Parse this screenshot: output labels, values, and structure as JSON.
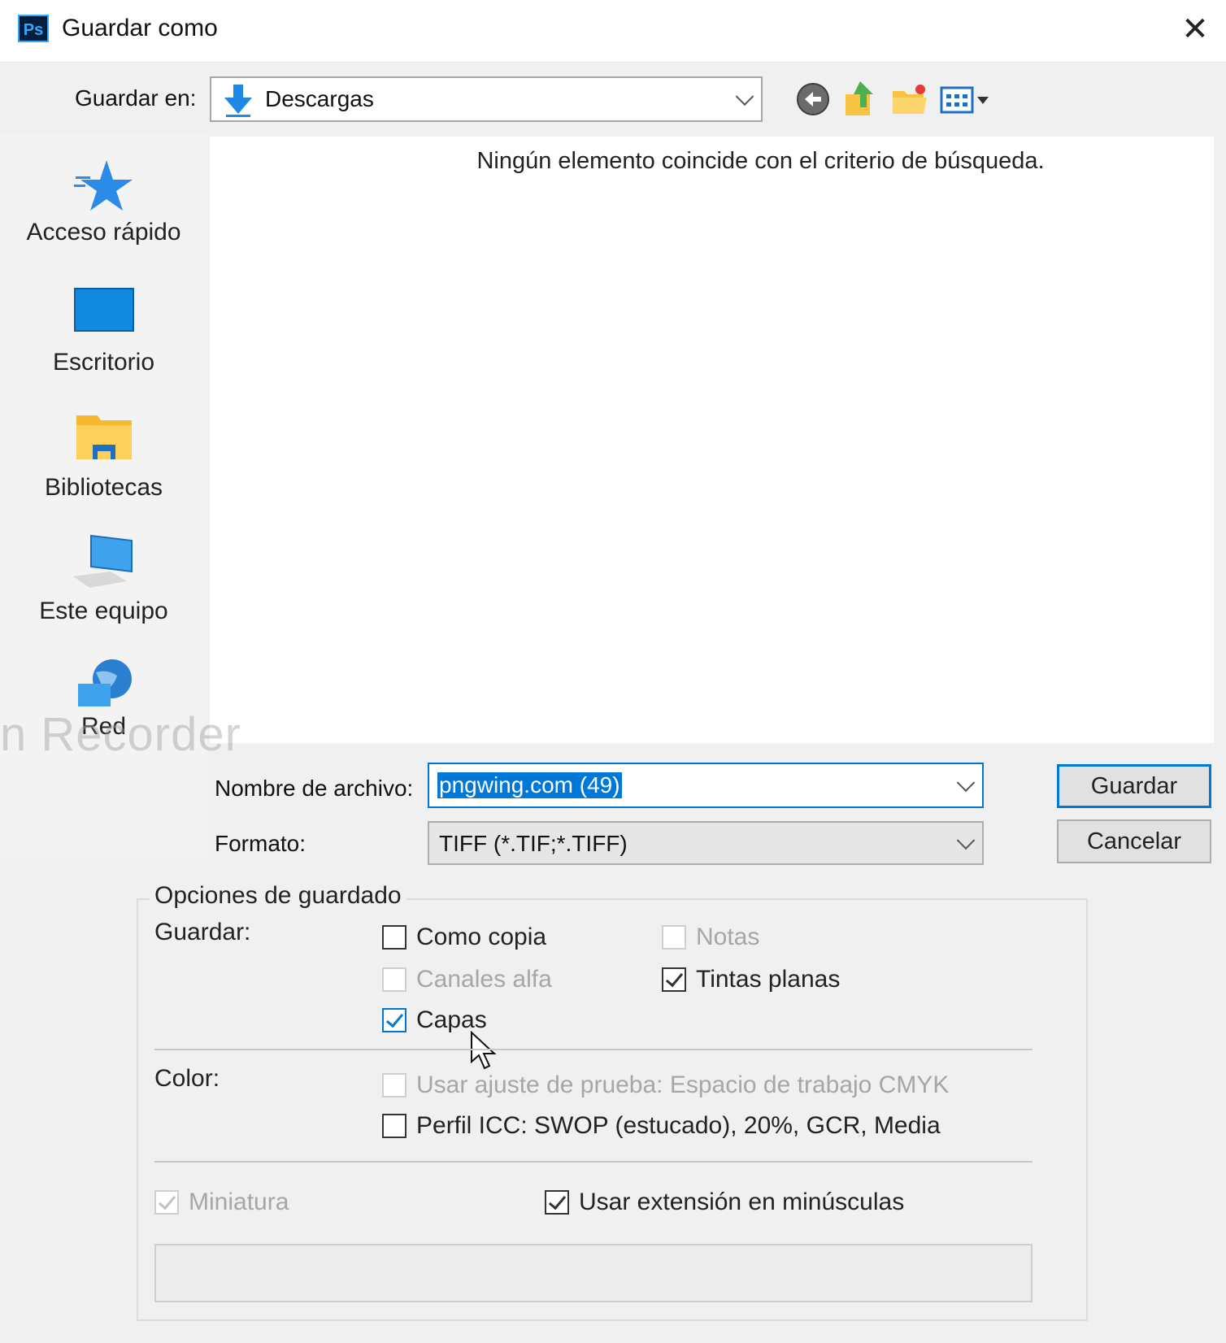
{
  "window": {
    "app_icon_text": "Ps",
    "title": "Guardar como",
    "close_glyph": "✕"
  },
  "location": {
    "label": "Guardar en:",
    "value": "Descargas"
  },
  "sidebar": {
    "items": [
      {
        "label": "Acceso rápido",
        "icon": "star-icon"
      },
      {
        "label": "Escritorio",
        "icon": "desktop-icon"
      },
      {
        "label": "Bibliotecas",
        "icon": "libraries-icon"
      },
      {
        "label": "Este equipo",
        "icon": "computer-icon"
      },
      {
        "label": "Red",
        "icon": "network-icon"
      }
    ]
  },
  "file_list": {
    "empty_message": "Ningún elemento coincide con el criterio de búsqueda."
  },
  "file_name": {
    "label": "Nombre de archivo:",
    "value": "pngwing.com (49)"
  },
  "format": {
    "label": "Formato:",
    "value": "TIFF (*.TIF;*.TIFF)"
  },
  "buttons": {
    "save": "Guardar",
    "cancel": "Cancelar"
  },
  "options": {
    "group_title": "Opciones de guardado",
    "save_label": "Guardar:",
    "como_copia": "Como copia",
    "notas": "Notas",
    "canales_alfa": "Canales alfa",
    "tintas_planas": "Tintas planas",
    "capas": "Capas",
    "color_label": "Color:",
    "ajuste_prueba": "Usar ajuste de prueba: Espacio de trabajo CMYK",
    "perfil_icc": "Perfil ICC: SWOP (estucado), 20%, GCR, Media",
    "miniatura": "Miniatura",
    "extension_minusculas": "Usar extensión en minúsculas"
  },
  "watermark": "n Recorder",
  "colors": {
    "accent": "#0078d7",
    "dialog_bg": "#f0f0f0"
  }
}
